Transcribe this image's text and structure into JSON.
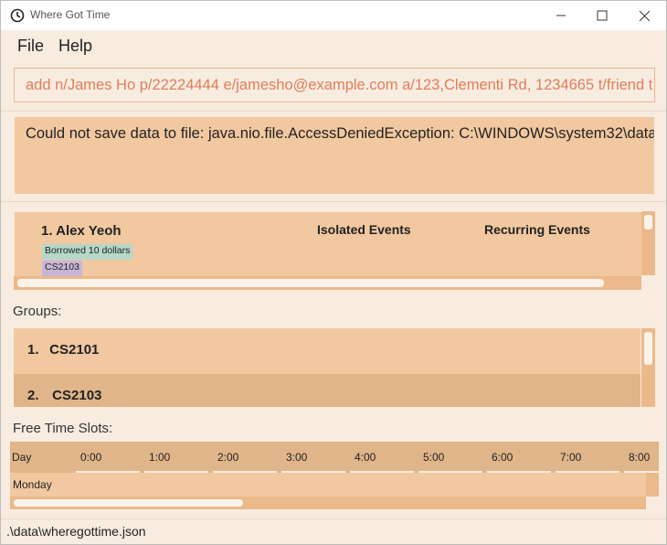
{
  "window": {
    "title": "Where Got Time",
    "icon": "clock-icon",
    "controls": [
      "minimize-icon",
      "maximize-icon",
      "close-icon"
    ]
  },
  "menu": {
    "file": "File",
    "help": "Help"
  },
  "command": {
    "value": "add n/James Ho p/22224444 e/jamesho@example.com a/123,Clementi Rd, 1234665 t/friend t"
  },
  "result": {
    "message": "Could not save data to file: java.nio.file.AccessDeniedException: C:\\WINDOWS\\system32\\data"
  },
  "persons": {
    "items": [
      {
        "name": "1. Alex Yeoh",
        "tags": [
          "Borrowed 10 dollars",
          "CS2103"
        ]
      }
    ],
    "columns": {
      "isolated": "Isolated Events",
      "recurring": "Recurring Events"
    }
  },
  "groups": {
    "label": "Groups:",
    "items": [
      {
        "index": "1.",
        "name": "CS2101"
      },
      {
        "index": "2.",
        "name": "CS2103"
      }
    ]
  },
  "free_time": {
    "label": "Free Time Slots:",
    "header_day": "Day",
    "hours": [
      "0:00",
      "1:00",
      "2:00",
      "3:00",
      "4:00",
      "5:00",
      "6:00",
      "7:00",
      "8:00"
    ],
    "rows": [
      {
        "day": "Monday"
      }
    ]
  },
  "status": {
    "file_path": ".\\data\\wheregottime.json"
  },
  "colors": {
    "background": "#f8ece0",
    "card": "#f1c8a0",
    "card_alt": "#e0b58a",
    "accent": "#ebb98a",
    "command_text": "#e17d5a",
    "tag_borrowed": "#b6d7c9",
    "tag_course": "#c9b6d7"
  }
}
